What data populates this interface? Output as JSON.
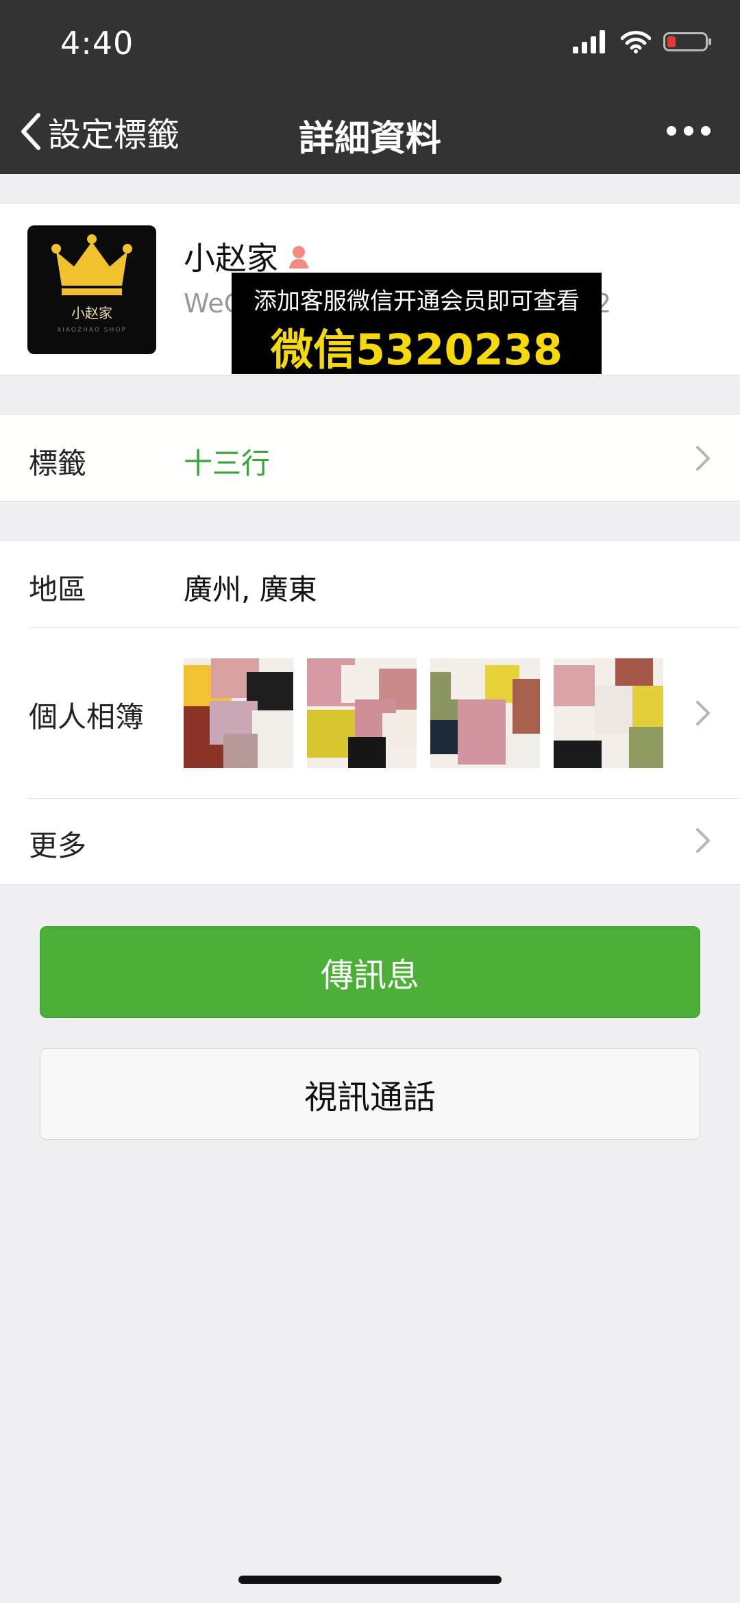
{
  "status": {
    "time": "4:40"
  },
  "nav": {
    "back_label": "設定標籤",
    "title": "詳細資料"
  },
  "profile": {
    "avatar_text": "小赵家",
    "avatar_subtext": "XIAOZHAO SHOP",
    "nickname": "小赵家",
    "wechat_id_prefix": "WeC",
    "wechat_id_tail": "2"
  },
  "promo": {
    "line1": "添加客服微信开通会员即可查看",
    "line2": "微信5320238"
  },
  "tag_row": {
    "label": "標籤",
    "value": "十三行"
  },
  "region_row": {
    "label": "地區",
    "value": "廣州, 廣東"
  },
  "album_row": {
    "label": "個人相簿"
  },
  "more_row": {
    "label": "更多"
  },
  "buttons": {
    "message": "傳訊息",
    "video_call": "視訊通話"
  },
  "colors": {
    "accent_green": "#4caf37",
    "tag_green": "#3aa33a",
    "nav_bg": "#333334",
    "battery_low": "#e53935",
    "promo_yellow": "#f5d90a"
  }
}
